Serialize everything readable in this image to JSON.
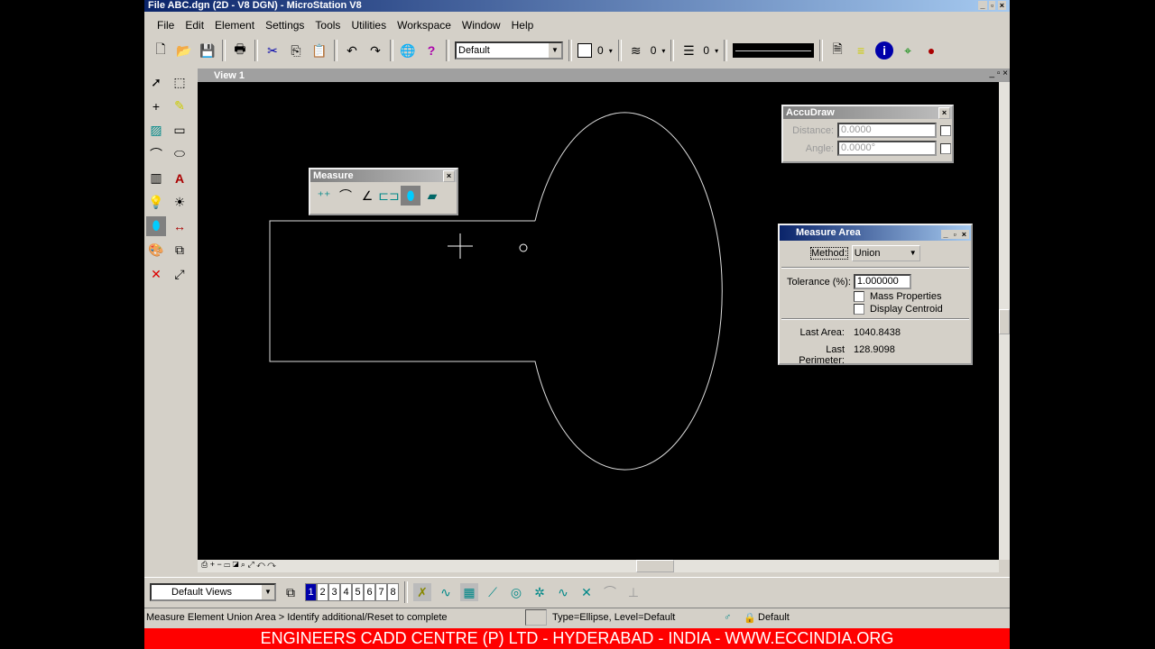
{
  "window": {
    "title": "File ABC.dgn (2D - V8 DGN) - MicroStation V8"
  },
  "menu": [
    "File",
    "Edit",
    "Element",
    "Settings",
    "Tools",
    "Utilities",
    "Workspace",
    "Window",
    "Help"
  ],
  "toolbar": {
    "level": "Default",
    "color": "0",
    "style": "0",
    "weight": "0"
  },
  "view": {
    "title": "View 1"
  },
  "measure_toolbox": {
    "title": "Measure"
  },
  "accudraw": {
    "title": "AccuDraw",
    "distance_label": "Distance:",
    "distance": "0.0000",
    "angle_label": "Angle:",
    "angle": "0.0000°"
  },
  "measure_area": {
    "title": "Measure Area",
    "method_label": "Method:",
    "method": "Union",
    "tolerance_label": "Tolerance (%):",
    "tolerance": "1.000000",
    "mass_label": "Mass Properties",
    "centroid_label": "Display Centroid",
    "area_label": "Last Area:",
    "area": "1040.8438",
    "perimeter_label": "Last Perimeter:",
    "perimeter": "128.9098"
  },
  "bottom": {
    "views_combo": "Default Views",
    "view_numbers": [
      "1",
      "2",
      "3",
      "4",
      "5",
      "6",
      "7",
      "8"
    ]
  },
  "status": {
    "prompt": "Measure Element Union Area > Identify additional/Reset to complete",
    "element": "Type=Ellipse, Level=Default",
    "level": "Default"
  },
  "banner": "ENGINEERS CADD CENTRE (P) LTD - HYDERABAD - INDIA - WWW.ECCINDIA.ORG",
  "colors": {
    "banner": "#ff0000",
    "titlebar": "#0a246a"
  }
}
